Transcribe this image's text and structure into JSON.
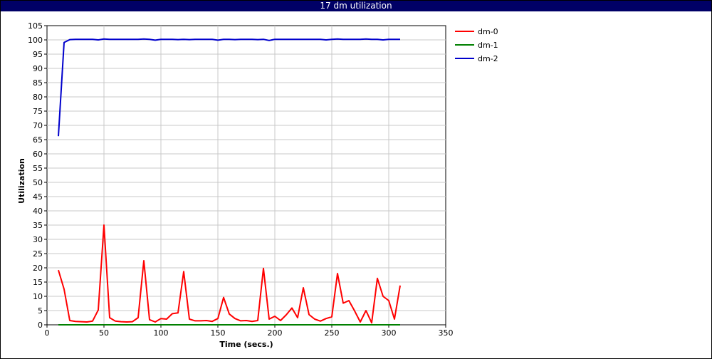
{
  "window": {
    "title": "17 dm utilization"
  },
  "chart_data": {
    "type": "line",
    "title": "17 dm utilization",
    "xlabel": "Time (secs.)",
    "ylabel": "Utilization",
    "xlim": [
      0,
      350
    ],
    "ylim": [
      0,
      105
    ],
    "xticks": [
      0,
      50,
      100,
      150,
      200,
      250,
      300,
      350
    ],
    "yticks": [
      0,
      5,
      10,
      15,
      20,
      25,
      30,
      35,
      40,
      45,
      50,
      55,
      60,
      65,
      70,
      75,
      80,
      85,
      90,
      95,
      100,
      105
    ],
    "grid": true,
    "legend_position": "right",
    "x": [
      10,
      15,
      20,
      25,
      30,
      35,
      40,
      45,
      50,
      55,
      60,
      65,
      70,
      75,
      80,
      85,
      90,
      95,
      100,
      105,
      110,
      115,
      120,
      125,
      130,
      135,
      140,
      145,
      150,
      155,
      160,
      165,
      170,
      175,
      180,
      185,
      190,
      195,
      200,
      205,
      210,
      215,
      220,
      225,
      230,
      235,
      240,
      245,
      250,
      255,
      260,
      265,
      270,
      275,
      280,
      285,
      290,
      295,
      300,
      305,
      310
    ],
    "series": [
      {
        "name": "dm-0",
        "color": "#ff0000",
        "values": [
          19.2,
          12.5,
          1.5,
          1.2,
          1.1,
          1.0,
          1.3,
          5.2,
          35.0,
          2.5,
          1.3,
          1.1,
          1.0,
          1.1,
          2.5,
          22.5,
          1.8,
          1.0,
          2.2,
          2.0,
          3.9,
          4.2,
          18.7,
          2.0,
          1.4,
          1.4,
          1.5,
          1.2,
          2.2,
          9.6,
          3.8,
          2.2,
          1.4,
          1.5,
          1.2,
          1.5,
          19.8,
          2.0,
          3.0,
          1.5,
          3.5,
          5.9,
          2.5,
          13.0,
          3.6,
          2.0,
          1.3,
          2.2,
          2.8,
          18.0,
          7.6,
          8.5,
          4.9,
          1.0,
          5.0,
          0.7,
          16.3,
          10.0,
          8.5,
          2.0,
          13.8
        ]
      },
      {
        "name": "dm-1",
        "color": "#008000",
        "values": [
          0,
          0,
          0,
          0,
          0,
          0,
          0,
          0,
          0,
          0,
          0,
          0,
          0,
          0,
          0,
          0,
          0,
          0,
          0,
          0,
          0,
          0,
          0,
          0,
          0,
          0,
          0,
          0,
          0,
          0,
          0,
          0,
          0,
          0,
          0,
          0,
          0,
          0,
          0,
          0,
          0,
          0,
          0,
          0,
          0,
          0,
          0,
          0,
          0,
          0,
          0,
          0,
          0,
          0,
          0,
          0,
          0,
          0,
          0,
          0,
          0
        ]
      },
      {
        "name": "dm-2",
        "color": "#0000cc",
        "values": [
          66.2,
          99.1,
          100.1,
          100.2,
          100.2,
          100.2,
          100.2,
          100.0,
          100.3,
          100.2,
          100.2,
          100.2,
          100.2,
          100.2,
          100.2,
          100.3,
          100.2,
          99.9,
          100.2,
          100.2,
          100.2,
          100.1,
          100.2,
          100.1,
          100.2,
          100.2,
          100.2,
          100.2,
          99.9,
          100.2,
          100.2,
          100.1,
          100.2,
          100.2,
          100.2,
          100.1,
          100.2,
          99.8,
          100.2,
          100.2,
          100.2,
          100.2,
          100.2,
          100.2,
          100.2,
          100.2,
          100.2,
          100.0,
          100.2,
          100.3,
          100.2,
          100.2,
          100.2,
          100.2,
          100.3,
          100.2,
          100.2,
          100.0,
          100.2,
          100.2,
          100.2
        ]
      }
    ]
  }
}
